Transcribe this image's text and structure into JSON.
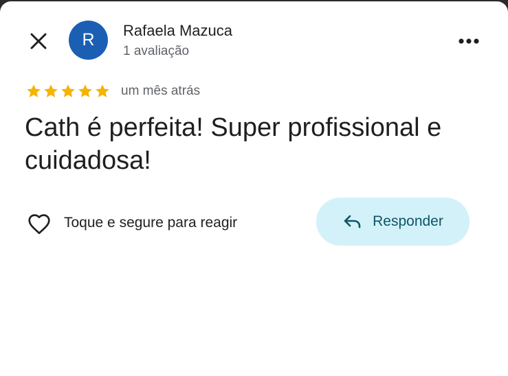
{
  "header": {
    "avatar_initial": "R",
    "user_name": "Rafaela Mazuca",
    "review_count": "1 avaliação"
  },
  "review": {
    "rating": 5,
    "max_rating": 5,
    "time_ago": "um mês atrás",
    "text": "Cath é perfeita! Super profissional e cuidadosa!"
  },
  "actions": {
    "react_label": "Toque e segure para reagir",
    "reply_label": "Responder"
  },
  "icons": {
    "close": "close-icon",
    "more": "more-horizontal-icon",
    "star": "star-icon",
    "heart": "heart-outline-icon",
    "reply": "reply-arrow-icon"
  },
  "colors": {
    "avatar_bg": "#1a5fb4",
    "star": "#f4b400",
    "reply_button_bg": "#d3f1f9",
    "reply_button_text": "#0b5566",
    "secondary_text": "#5f6368"
  }
}
